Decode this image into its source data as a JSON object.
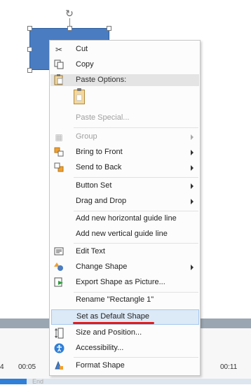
{
  "menu": {
    "cut": "Cut",
    "copy": "Copy",
    "paste_options": "Paste Options:",
    "paste_special": "Paste Special...",
    "group": "Group",
    "bring_to_front": "Bring to Front",
    "send_to_back": "Send to Back",
    "button_set": "Button Set",
    "drag_and_drop": "Drag and Drop",
    "add_horizontal_guide": "Add new horizontal guide line",
    "add_vertical_guide": "Add new vertical guide line",
    "edit_text": "Edit Text",
    "change_shape": "Change Shape",
    "export_shape": "Export Shape as Picture...",
    "rename": "Rename \"Rectangle 1\"",
    "set_default_shape": "Set as Default Shape",
    "size_position": "Size and Position...",
    "accessibility": "Accessibility...",
    "format_shape": "Format Shape"
  },
  "timeline": {
    "ticks": [
      "4",
      "00:05",
      "00:11"
    ],
    "end_label": "End"
  },
  "colors": {
    "shape_fill": "#4a7cc1",
    "highlight": "#dce9f6",
    "annotation_red": "#e01b1b"
  }
}
